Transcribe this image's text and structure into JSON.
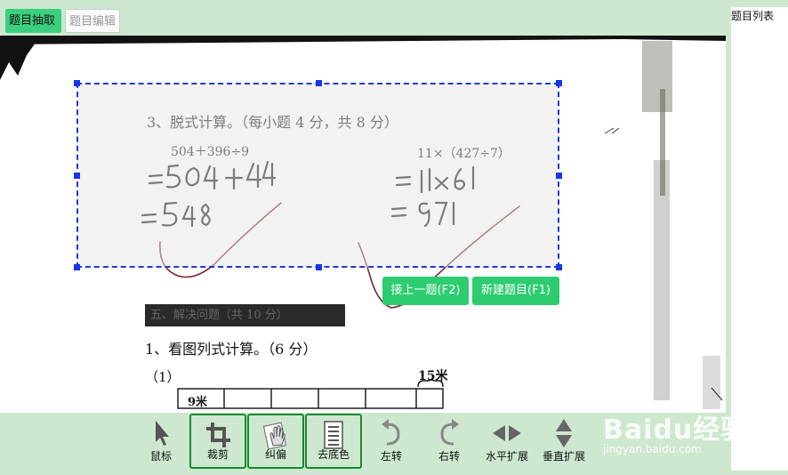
{
  "tabs": [
    {
      "label": "题目抽取",
      "active": true
    },
    {
      "label": "题目编辑",
      "active": false
    }
  ],
  "right_panel": {
    "title": "题目列表"
  },
  "document": {
    "question_title": "3、脱式计算。（每小题 4 分，共 8 分）",
    "expr1": "504＋396÷9",
    "expr2": "11×（427÷7）",
    "section_header": "五、解决问题（共 10 分）",
    "q1_title": "1、看图列式计算。（6 分）",
    "q1_sub": "（1）",
    "label_15m": "15米",
    "label_9m": "9米"
  },
  "actions": {
    "prev_label": "接上一题(F2)",
    "new_label": "新建题目(F1)"
  },
  "toolbar": [
    {
      "label": "鼠标",
      "icon": "cursor-icon",
      "outlined": false
    },
    {
      "label": "裁剪",
      "icon": "crop-icon",
      "outlined": true
    },
    {
      "label": "纠偏",
      "icon": "hand-icon",
      "outlined": true
    },
    {
      "label": "去底色",
      "icon": "document-lines-icon",
      "outlined": true
    },
    {
      "label": "左转",
      "icon": "rotate-left-icon",
      "outlined": false
    },
    {
      "label": "右转",
      "icon": "rotate-right-icon",
      "outlined": false
    },
    {
      "label": "水平扩展",
      "icon": "horizontal-expand-icon",
      "outlined": false
    },
    {
      "label": "垂直扩展",
      "icon": "vertical-expand-icon",
      "outlined": false
    }
  ],
  "watermark": {
    "logo": "Baidu经验",
    "url": "jingyan.baidu.com"
  },
  "colors": {
    "accent": "#2ecc71",
    "selection": "#1f3bd6",
    "background": "#cde8cf"
  }
}
